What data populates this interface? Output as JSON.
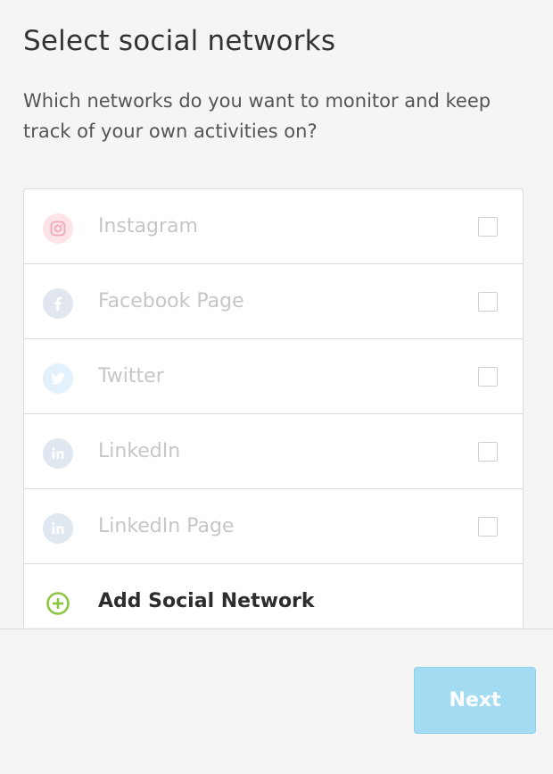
{
  "header": {
    "title": "Select social networks",
    "subtitle": "Which networks do you want to monitor and keep track of your own activities on?"
  },
  "networks": [
    {
      "label": "Instagram",
      "icon": "instagram-icon",
      "icon_bg": "#fde4e8",
      "icon_color": "#f0a8b6",
      "checked": false
    },
    {
      "label": "Facebook Page",
      "icon": "facebook-icon",
      "icon_bg": "#e1e6ef",
      "icon_color": "#ffffff",
      "checked": false
    },
    {
      "label": "Twitter",
      "icon": "twitter-icon",
      "icon_bg": "#e2f1fb",
      "icon_color": "#ffffff",
      "checked": false
    },
    {
      "label": "LinkedIn",
      "icon": "linkedin-icon",
      "icon_bg": "#dfe8f0",
      "icon_color": "#ffffff",
      "checked": false
    },
    {
      "label": "LinkedIn Page",
      "icon": "linkedin-icon",
      "icon_bg": "#dfe8f0",
      "icon_color": "#ffffff",
      "checked": false
    }
  ],
  "add_network": {
    "label": "Add Social Network",
    "icon": "plus-circle-icon",
    "icon_color": "#8cc63f"
  },
  "footer": {
    "next_label": "Next",
    "next_color": "#a3dbf2"
  }
}
